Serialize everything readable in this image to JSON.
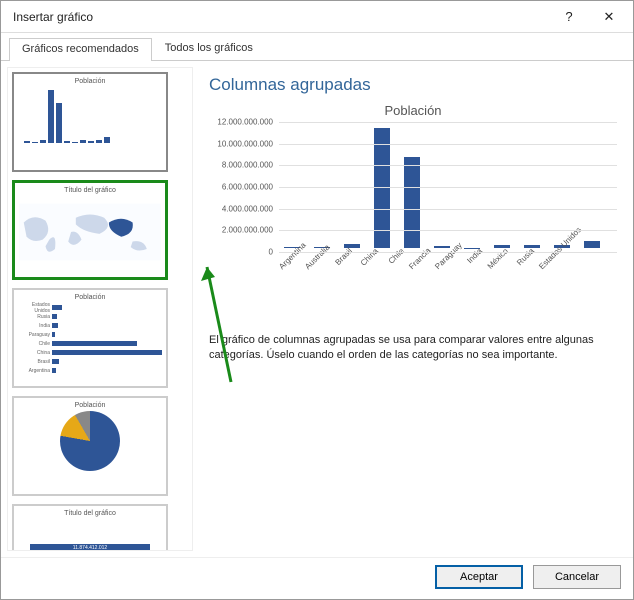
{
  "window": {
    "title": "Insertar gráfico"
  },
  "tabs": {
    "recommended": "Gráficos recomendados",
    "all": "Todos los gráficos"
  },
  "thumbnails": {
    "col_title": "Población",
    "map_title": "Título del gráfico",
    "barh_title": "Población",
    "pie_title": "Población",
    "funnel_title": "Título del gráfico"
  },
  "preview": {
    "type_label": "Columnas agrupadas",
    "chart_title": "Población",
    "description": "El gráfico de columnas agrupadas se usa para comparar valores entre algunas categorías. Úselo cuando el orden de las categorías no sea importante."
  },
  "buttons": {
    "ok": "Aceptar",
    "cancel": "Cancelar"
  },
  "chart_data": {
    "type": "bar",
    "title": "Población",
    "xlabel": "",
    "ylabel": "",
    "categories": [
      "Argentina",
      "Australia",
      "Brasil",
      "China",
      "Chile",
      "Francia",
      "Paraguay",
      "India",
      "México",
      "Rusia",
      "Estados Unidos"
    ],
    "values": [
      100000000,
      50000000,
      400000000,
      11400000000,
      8700000000,
      200000000,
      30000000,
      300000000,
      250000000,
      300000000,
      700000000
    ],
    "ylim": [
      0,
      12000000000
    ],
    "y_ticks": [
      "12.000.000.000",
      "10.000.000.000",
      "8.000.000.000",
      "6.000.000.000",
      "4.000.000.000",
      "2.000.000.000",
      "0"
    ]
  }
}
